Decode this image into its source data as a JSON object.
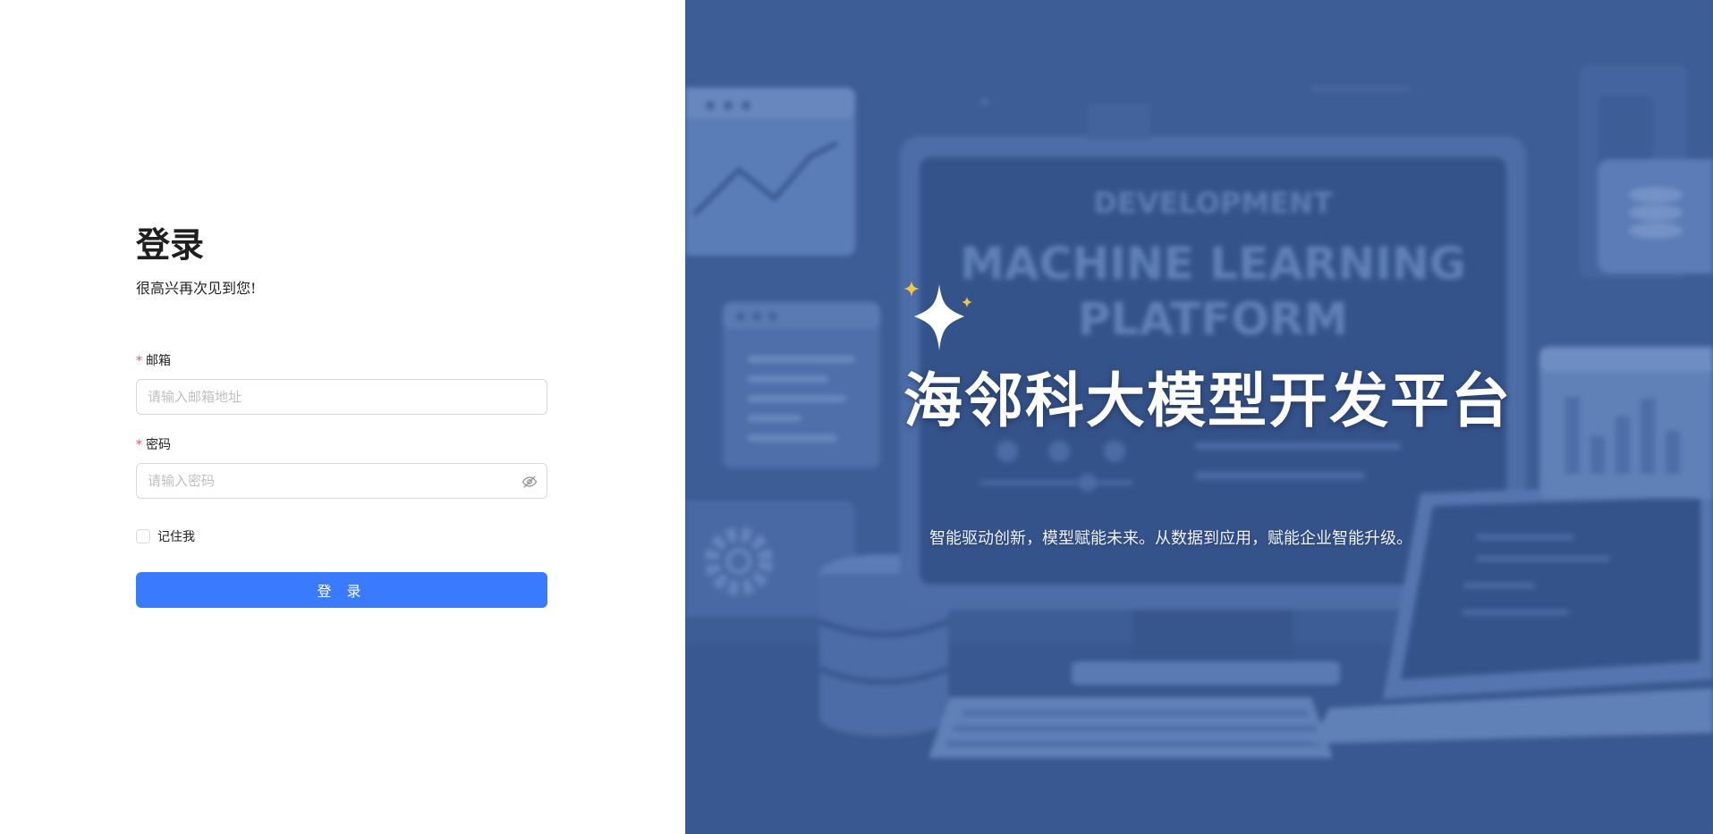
{
  "login": {
    "title": "登录",
    "subtitle": "很高兴再次见到您!",
    "email_label": "邮箱",
    "email_placeholder": "请输入邮箱地址",
    "email_value": "",
    "password_label": "密码",
    "password_placeholder": "请输入密码",
    "password_value": "",
    "required_mark": "*",
    "remember_label": "记住我",
    "remember_checked": false,
    "submit_label": "登 录",
    "submit_color": "#3a7afe"
  },
  "hero": {
    "title": "海邻科大模型开发平台",
    "subtitle": "智能驱动创新，模型赋能未来。从数据到应用，赋能企业智能升级。",
    "background_texts": {
      "heading_small": "DEVELOPMENT",
      "heading_line1": "MACHINE LEARNING",
      "heading_line2": "PLATFORM"
    },
    "sparkle_icon": "sparkle-icon",
    "background_color": "#44639b"
  },
  "icons": {
    "password_toggle": "eye-off-icon",
    "sparkle": "sparkle-icon"
  }
}
